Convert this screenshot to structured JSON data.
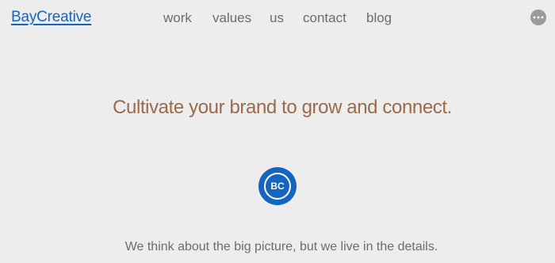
{
  "header": {
    "logo_text": "BayCreative",
    "nav": [
      {
        "label": "work"
      },
      {
        "label": "values"
      },
      {
        "label": "us"
      },
      {
        "label": "contact"
      },
      {
        "label": "blog"
      }
    ],
    "more_icon": "more-horizontal-icon"
  },
  "hero": {
    "title": "Cultivate your brand to grow and connect.",
    "badge_text": "BC",
    "tagline": "We think about the big picture, but we live in the details."
  },
  "colors": {
    "background": "#ededed",
    "brand_blue": "#1565c0",
    "title_brown": "#9a6a4c",
    "nav_gray": "#6c6c6c",
    "more_button_gray": "#9b9b9b"
  }
}
